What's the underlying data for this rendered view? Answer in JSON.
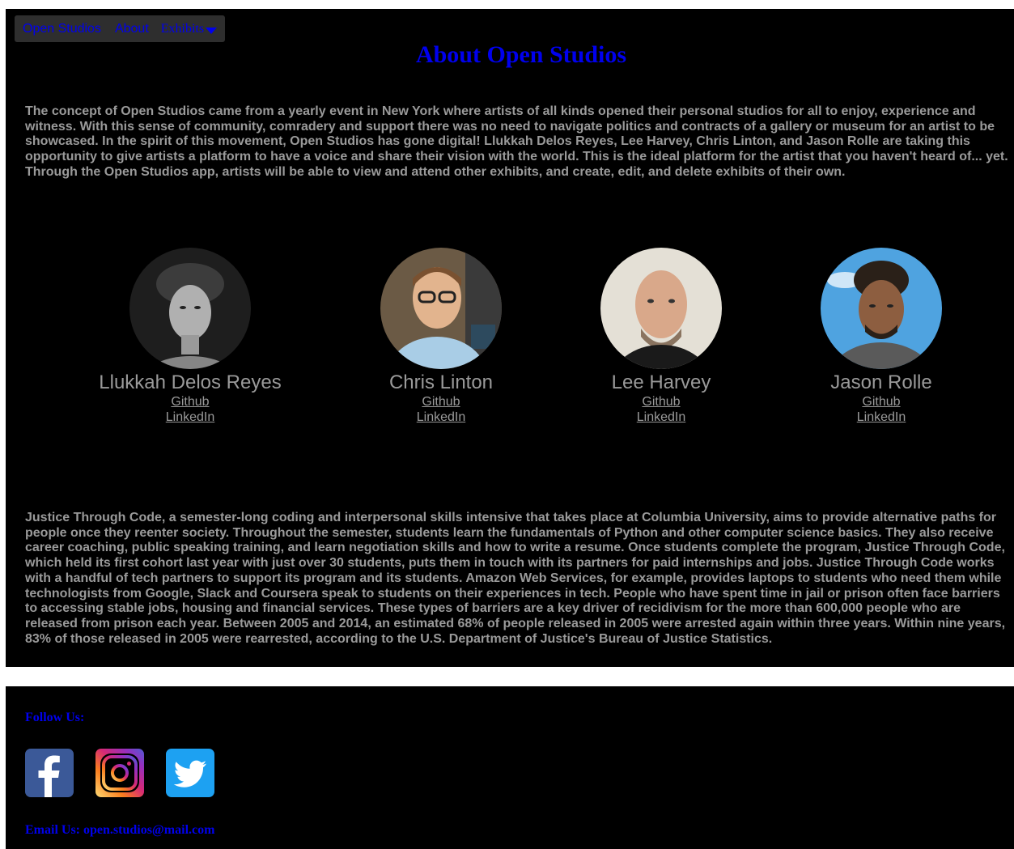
{
  "nav": {
    "home": "Open Studios",
    "about": "About",
    "exhibits": "Exhibits"
  },
  "page_title": "About Open Studios",
  "intro": "The concept of Open Studios came from a yearly event in New York where artists of all kinds opened their personal studios for all to enjoy, experience and witness. With this sense of community, comradery and support there was no need to navigate politics and contracts of a gallery or museum for an artist to be showcased. In the spirit of this movement, Open Studios has gone digital! Llukkah Delos Reyes, Lee Harvey, Chris Linton, and Jason Rolle are taking this opportunity to give artists a platform to have a voice and share their vision with the world. This is the ideal platform for the artist that you haven't heard of... yet. Through the Open Studios app, artists will be able to view and attend other exhibits, and create, edit, and delete exhibits of their own.",
  "team": [
    {
      "name": "Llukkah Delos Reyes",
      "github": "Github",
      "linkedin": "LinkedIn"
    },
    {
      "name": "Chris Linton",
      "github": "Github",
      "linkedin": "LinkedIn"
    },
    {
      "name": "Lee Harvey",
      "github": "Github",
      "linkedin": "LinkedIn"
    },
    {
      "name": "Jason Rolle",
      "github": "Github",
      "linkedin": "LinkedIn"
    }
  ],
  "jtc": "Justice Through Code, a semester-long coding and interpersonal skills intensive that takes place at Columbia University, aims to provide alternative paths for people once they reenter society. Throughout the semester, students learn the fundamentals of Python and other computer science basics. They also receive career coaching, public speaking training, and learn negotiation skills and how to write a resume. Once students complete the program, Justice Through Code, which held its first cohort last year with just over 30 students, puts them in touch with its partners for paid internships and jobs. Justice Through Code works with a handful of tech partners to support its program and its students. Amazon Web Services, for example, provides laptops to students who need them while technologists from Google, Slack and Coursera speak to students on their experiences in tech. People who have spent time in jail or prison often face barriers to accessing stable jobs, housing and financial services. These types of barriers are a key driver of recidivism for the more than 600,000 people who are released from prison each year. Between 2005 and 2014, an estimated 68% of people released in 2005 were arrested again within three years. Within nine years, 83% of those released in 2005 were rearrested, according to the U.S. Department of Justice's Bureau of Justice Statistics.",
  "footer": {
    "follow": "Follow Us:",
    "email": "Email Us: open.studios@mail.com",
    "icons": [
      "facebook-icon",
      "instagram-icon",
      "twitter-icon"
    ]
  },
  "colors": {
    "background": "#000000",
    "link": "#0000ee",
    "text": "#9a9a9a",
    "facebook": "#3b5998",
    "twitter": "#1da1f2"
  }
}
